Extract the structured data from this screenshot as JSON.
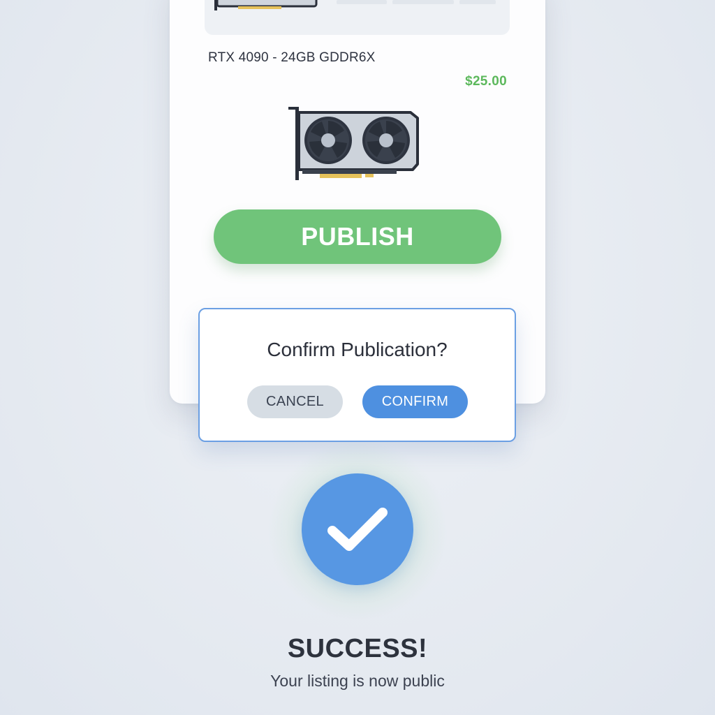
{
  "listing": {
    "title": "RTX 4090 - 24GB GDDR6X",
    "price": "$25.00",
    "image_icon": "graphics-card-icon",
    "publish_label": "PUBLISH"
  },
  "dialog": {
    "question": "Confirm Publication?",
    "cancel_label": "CANCEL",
    "confirm_label": "CONFIRM"
  },
  "success": {
    "icon": "checkmark-icon",
    "title": "SUCCESS!",
    "subtitle": "Your listing is now public"
  },
  "colors": {
    "publish": "#70c47a",
    "price": "#5cb85c",
    "confirm": "#4e90e0",
    "cancel": "#d6dde4",
    "success_circle": "#5797e3",
    "dialog_border": "#6b9fe3"
  }
}
